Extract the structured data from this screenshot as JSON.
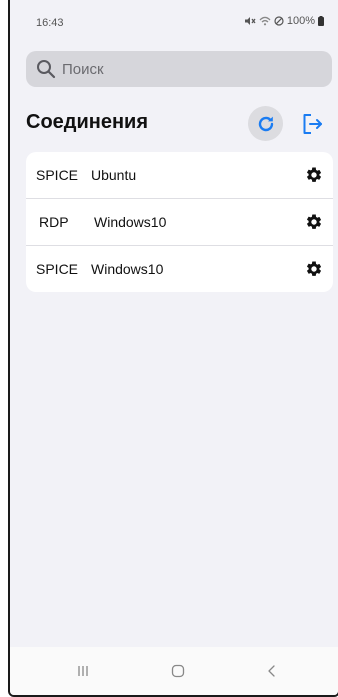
{
  "status_bar": {
    "time": "16:43",
    "battery": "100%"
  },
  "search": {
    "placeholder": "Поиск"
  },
  "header": {
    "title": "Соединения"
  },
  "connections": [
    {
      "protocol": "SPICE",
      "name": "Ubuntu"
    },
    {
      "protocol": "RDP",
      "name": "Windows10"
    },
    {
      "protocol": "SPICE",
      "name": "Windows10"
    }
  ],
  "colors": {
    "accent": "#1a7cf2",
    "background": "#f2f2f7",
    "card": "#ffffff",
    "search_bg": "#d6d6db"
  },
  "icons": {
    "search": "search-icon",
    "refresh": "refresh-icon",
    "logout": "logout-icon",
    "settings": "gear-icon",
    "nav_recents": "recents-icon",
    "nav_home": "home-icon",
    "nav_back": "back-icon"
  }
}
